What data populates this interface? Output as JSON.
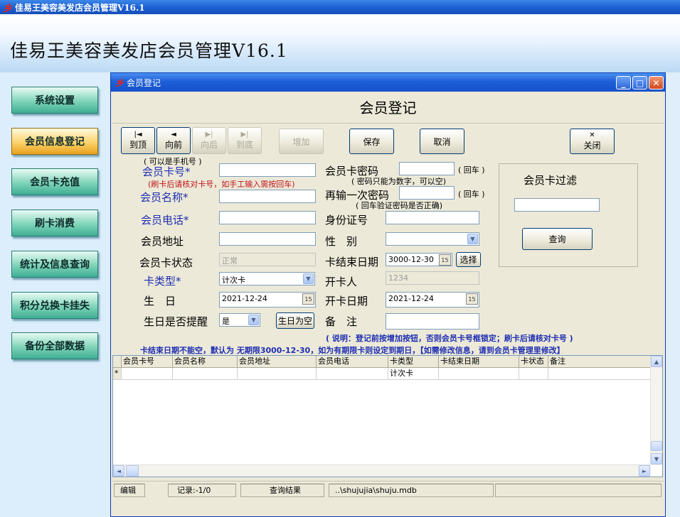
{
  "app": {
    "title": "佳易王美容美发店会员管理V16.1",
    "banner_title": "佳易王美容美发店会员管理V16.1"
  },
  "sidebar": {
    "items": [
      {
        "label": "系统设置"
      },
      {
        "label": "会员信息登记",
        "active": true
      },
      {
        "label": "会员卡充值"
      },
      {
        "label": "刷卡消费"
      },
      {
        "label": "统计及信息查询"
      },
      {
        "label": "积分兑换卡挂失"
      },
      {
        "label": "备份全部数据"
      }
    ]
  },
  "window": {
    "title": "会员登记",
    "heading": "会员登记",
    "controls": {
      "minimize": "_",
      "maximize": "□",
      "close": "✕"
    }
  },
  "toolbar": {
    "first": {
      "icon": "|◄",
      "label": "到顶"
    },
    "prev": {
      "icon": "◄",
      "label": "向前"
    },
    "next": {
      "icon": "▶|",
      "label": "向后"
    },
    "last": {
      "icon": "▶|",
      "label": "到底"
    },
    "add": "增加",
    "save": "保存",
    "cancel": "取消",
    "close": {
      "icon": "✕",
      "label": "关闭"
    }
  },
  "form": {
    "card_no_hint": "( 可以是手机号 )",
    "card_no_label": "会员卡号*",
    "card_no_value": "",
    "card_no_note": "(刷卡后请核对卡号，如手工输入需按回车)",
    "name_label": "会员名称*",
    "name_value": "",
    "phone_label": "会员电话*",
    "phone_value": "",
    "address_label": "会员地址",
    "address_value": "",
    "status_label": "会员卡状态",
    "status_value": "正常",
    "card_type_label": "卡类型*",
    "card_type_value": "计次卡",
    "birthday_label": "生　日",
    "birthday_value": "2021-12-24",
    "remind_label": "生日是否提醒",
    "remind_value": "是",
    "birthday_clear_btn": "生日为空",
    "password_label": "会员卡密码",
    "password_value": "",
    "enter_hint": "( 回车 )",
    "password_note": "( 密码只能为数字，可以空)",
    "password2_label": "再输一次密码",
    "password2_value": "",
    "enter_hint2": "( 回车 )",
    "password2_note": "( 回车验证密码是否正确)",
    "id_label": "身份证号",
    "id_value": "",
    "gender_label": "性　别",
    "gender_value": "",
    "expire_label": "卡结束日期",
    "expire_value": "3000-12-30",
    "select_btn": "选择",
    "opener_label": "开卡人",
    "opener_value": "1234",
    "open_date_label": "开卡日期",
    "open_date_value": "2021-12-24",
    "remark_label": "备　注",
    "remark_value": "",
    "filter_title": "会员卡过滤",
    "filter_value": "",
    "query_btn": "查询",
    "explain_1": "( 说明：登记前按增加按钮，否则会员卡号框锁定；刷卡后请核对卡号 )",
    "explain_2": "卡结束日期不能空，默认为 无期限3000-12-30，如为有期限卡则设定到期日，【如需修改信息，请到会员卡管理里修改】"
  },
  "grid": {
    "columns": [
      "会员卡号",
      "会员名称",
      "会员地址",
      "会员电话",
      "卡类型",
      "卡结束日期",
      "卡状态",
      "备注"
    ],
    "new_row_marker": "*",
    "new_row": [
      "",
      "",
      "",
      "",
      "计次卡",
      "",
      "",
      ""
    ]
  },
  "statusbar": {
    "mode": "编辑",
    "record": "记录:-1/0",
    "query_result": "查询结果",
    "db_path": "..\\shujujia\\shuju.mdb"
  },
  "icons": {
    "calendar": "15",
    "dropdown": "▼",
    "scroll_up": "▲",
    "scroll_down": "▼",
    "scroll_left": "◄",
    "scroll_right": "►"
  }
}
